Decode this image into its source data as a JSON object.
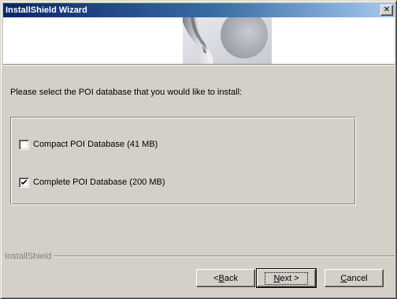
{
  "window": {
    "title": "InstallShield Wizard",
    "close_glyph": "✕"
  },
  "banner": {
    "graphic_icon": "installshield-banner-graphic"
  },
  "main": {
    "prompt": "Please select the POI database that you would like to install:",
    "options": [
      {
        "label": "Compact POI Database (41 MB)",
        "checked": false
      },
      {
        "label": "Complete POI Database (200 MB)",
        "checked": true
      }
    ]
  },
  "footer": {
    "brand": "InstallShield",
    "back": {
      "prefix": "< ",
      "mnemonic": "B",
      "rest": "ack"
    },
    "next": {
      "prefix": "",
      "mnemonic": "N",
      "rest": "ext >"
    },
    "cancel": {
      "prefix": "",
      "mnemonic": "C",
      "rest": "ancel"
    }
  },
  "colors": {
    "title_gradient_start": "#0a246a",
    "title_gradient_end": "#a6caf0",
    "face": "#d4d0c8"
  }
}
